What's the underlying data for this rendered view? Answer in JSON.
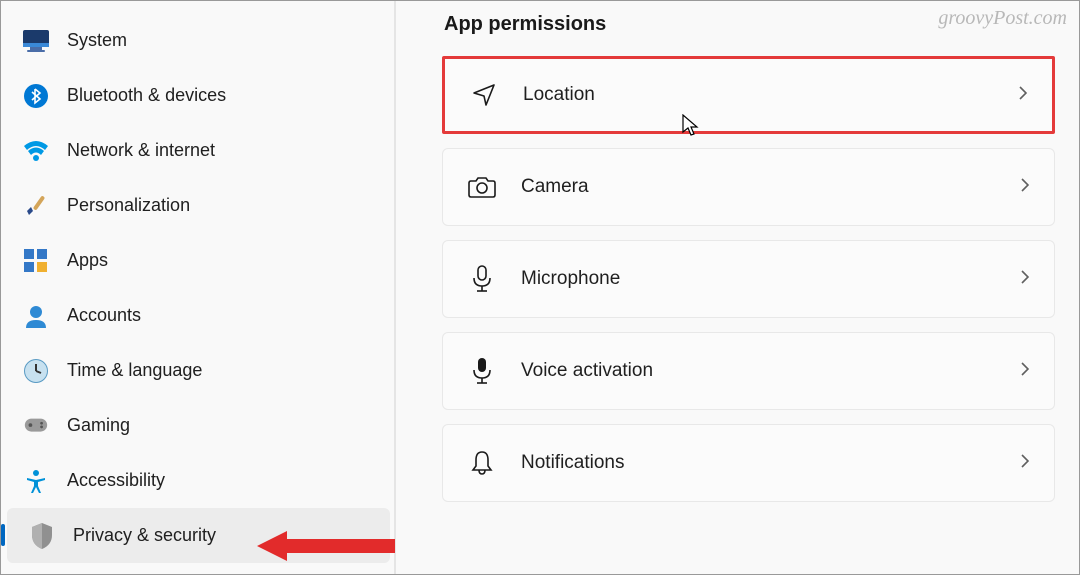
{
  "watermark": "groovyPost.com",
  "sidebar": {
    "items": [
      {
        "label": "System",
        "icon": "system"
      },
      {
        "label": "Bluetooth & devices",
        "icon": "bluetooth"
      },
      {
        "label": "Network & internet",
        "icon": "wifi"
      },
      {
        "label": "Personalization",
        "icon": "personalization"
      },
      {
        "label": "Apps",
        "icon": "apps"
      },
      {
        "label": "Accounts",
        "icon": "accounts"
      },
      {
        "label": "Time & language",
        "icon": "time"
      },
      {
        "label": "Gaming",
        "icon": "gaming"
      },
      {
        "label": "Accessibility",
        "icon": "accessibility"
      },
      {
        "label": "Privacy & security",
        "icon": "privacy"
      }
    ],
    "selected_index": 9
  },
  "main": {
    "section_title": "App permissions",
    "items": [
      {
        "label": "Location",
        "icon": "location",
        "highlighted": true
      },
      {
        "label": "Camera",
        "icon": "camera"
      },
      {
        "label": "Microphone",
        "icon": "microphone"
      },
      {
        "label": "Voice activation",
        "icon": "voice"
      },
      {
        "label": "Notifications",
        "icon": "notifications"
      }
    ]
  }
}
